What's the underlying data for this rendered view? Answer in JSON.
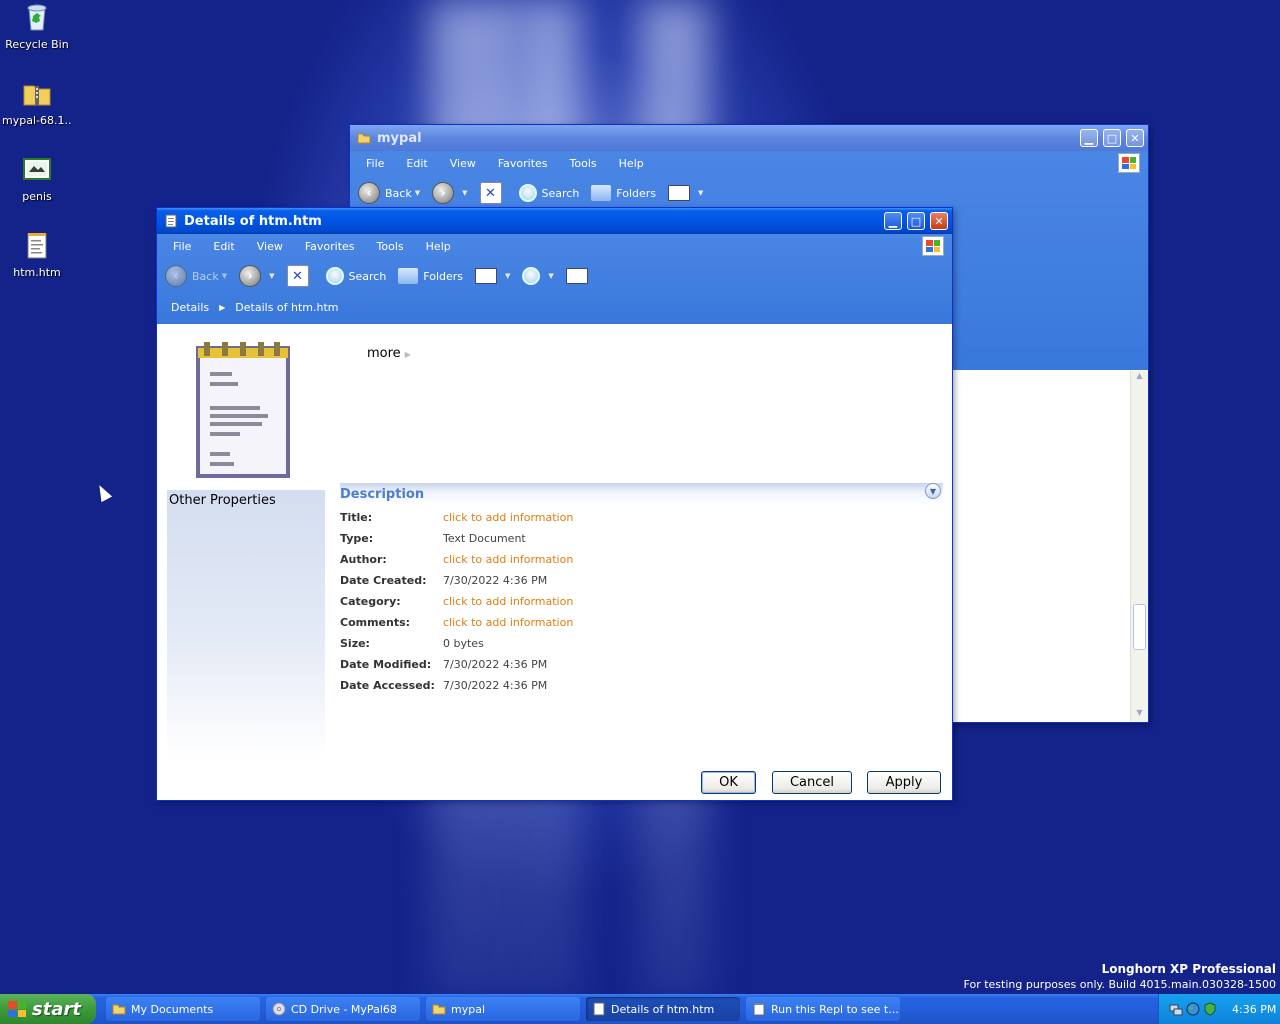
{
  "desktop": {
    "icons": [
      {
        "label": "Recycle Bin",
        "icon": "recycle-bin-icon"
      },
      {
        "label": "mypal-68.1...",
        "icon": "zip-folder-icon"
      },
      {
        "label": "penis",
        "icon": "image-file-icon"
      },
      {
        "label": "htm.htm",
        "icon": "text-document-icon"
      }
    ],
    "watermark": {
      "line1": "Longhorn XP Professional",
      "line2": "For testing purposes only. Build 4015.main.030328-1500"
    }
  },
  "back_window": {
    "title": "mypal",
    "menu": [
      "File",
      "Edit",
      "View",
      "Favorites",
      "Tools",
      "Help"
    ],
    "toolbar": {
      "back": "Back",
      "search": "Search",
      "folders": "Folders"
    }
  },
  "front_window": {
    "title": "Details of htm.htm",
    "menu": [
      "File",
      "Edit",
      "View",
      "Favorites",
      "Tools",
      "Help"
    ],
    "toolbar": {
      "back": "Back",
      "search": "Search",
      "folders": "Folders"
    },
    "breadcrumb": [
      "Details",
      "Details of htm.htm"
    ],
    "more_label": "more",
    "left_pane_title": "Other Properties",
    "description": {
      "title": "Description",
      "rows": [
        {
          "key": "Title:",
          "value": "click to add information",
          "link": true
        },
        {
          "key": "Type:",
          "value": "Text Document",
          "link": false
        },
        {
          "key": "Author:",
          "value": "click to add information",
          "link": true
        },
        {
          "key": "Date Created:",
          "value": "7/30/2022 4:36 PM",
          "link": false
        },
        {
          "key": "Category:",
          "value": "click to add information",
          "link": true
        },
        {
          "key": "Comments:",
          "value": "click to add information",
          "link": true
        },
        {
          "key": "Size:",
          "value": "0 bytes",
          "link": false
        },
        {
          "key": "Date Modified:",
          "value": "7/30/2022 4:36 PM",
          "link": false
        },
        {
          "key": "Date Accessed:",
          "value": "7/30/2022 4:36 PM",
          "link": false
        }
      ]
    },
    "buttons": {
      "ok": "OK",
      "cancel": "Cancel",
      "apply": "Apply"
    }
  },
  "taskbar": {
    "start_label": "start",
    "tasks": [
      {
        "label": "My Documents",
        "active": false
      },
      {
        "label": "CD Drive - MyPal68",
        "active": false
      },
      {
        "label": "mypal",
        "active": false
      },
      {
        "label": "Details of htm.htm",
        "active": true
      },
      {
        "label": "Run this Repl to see t...",
        "active": false
      }
    ],
    "clock": "4:36 PM"
  },
  "colors": {
    "titlebar": "#0055e5",
    "link": "#e07e10",
    "description_heading": "#4a7fd0",
    "start_green": "#3c9b3b"
  }
}
